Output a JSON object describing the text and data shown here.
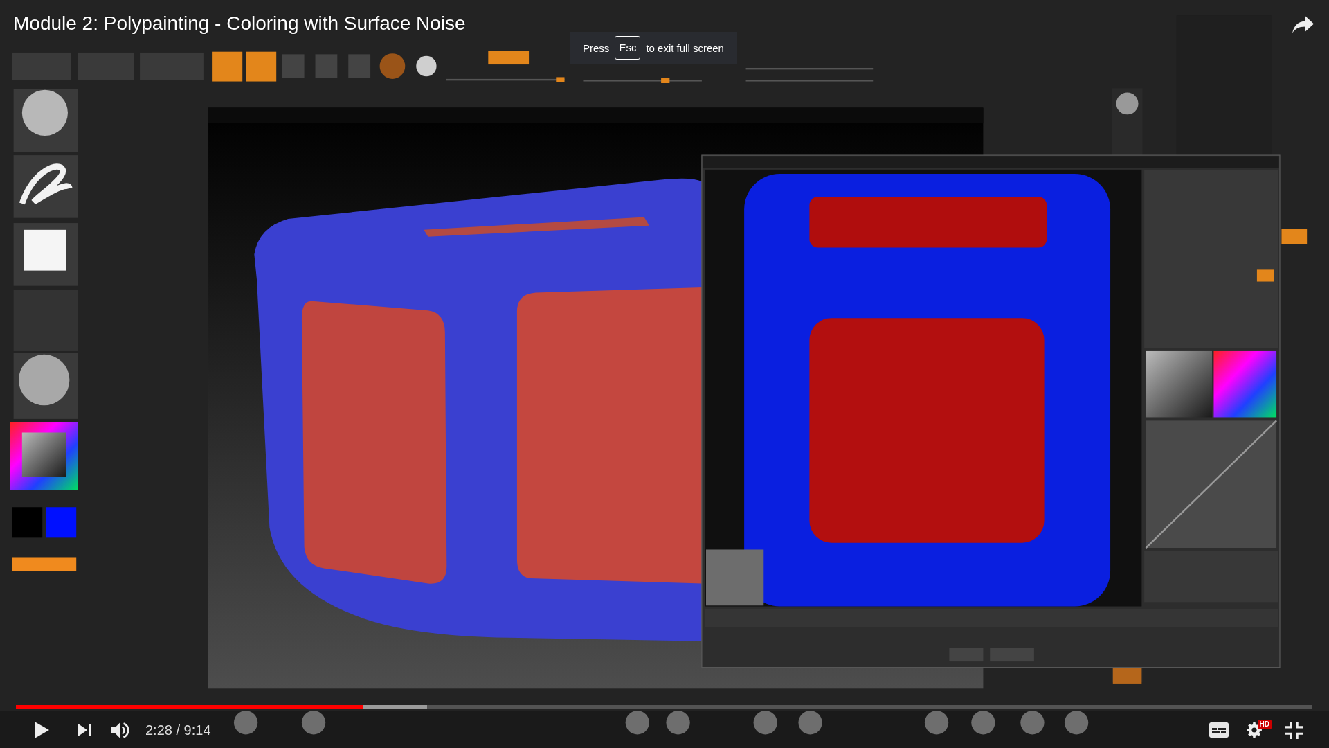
{
  "video": {
    "title": "Module 2: Polypainting - Coloring with Surface Noise"
  },
  "fullscreen_notice": {
    "before": "Press",
    "key": "Esc",
    "after": "to exit full screen"
  },
  "progress": {
    "level": 0.268,
    "buffer": {
      "level": 0.317
    }
  },
  "controls": {
    "playing": false,
    "time": "2:28 / 9:14",
    "subtitles": false,
    "quality_badge": "HD"
  }
}
